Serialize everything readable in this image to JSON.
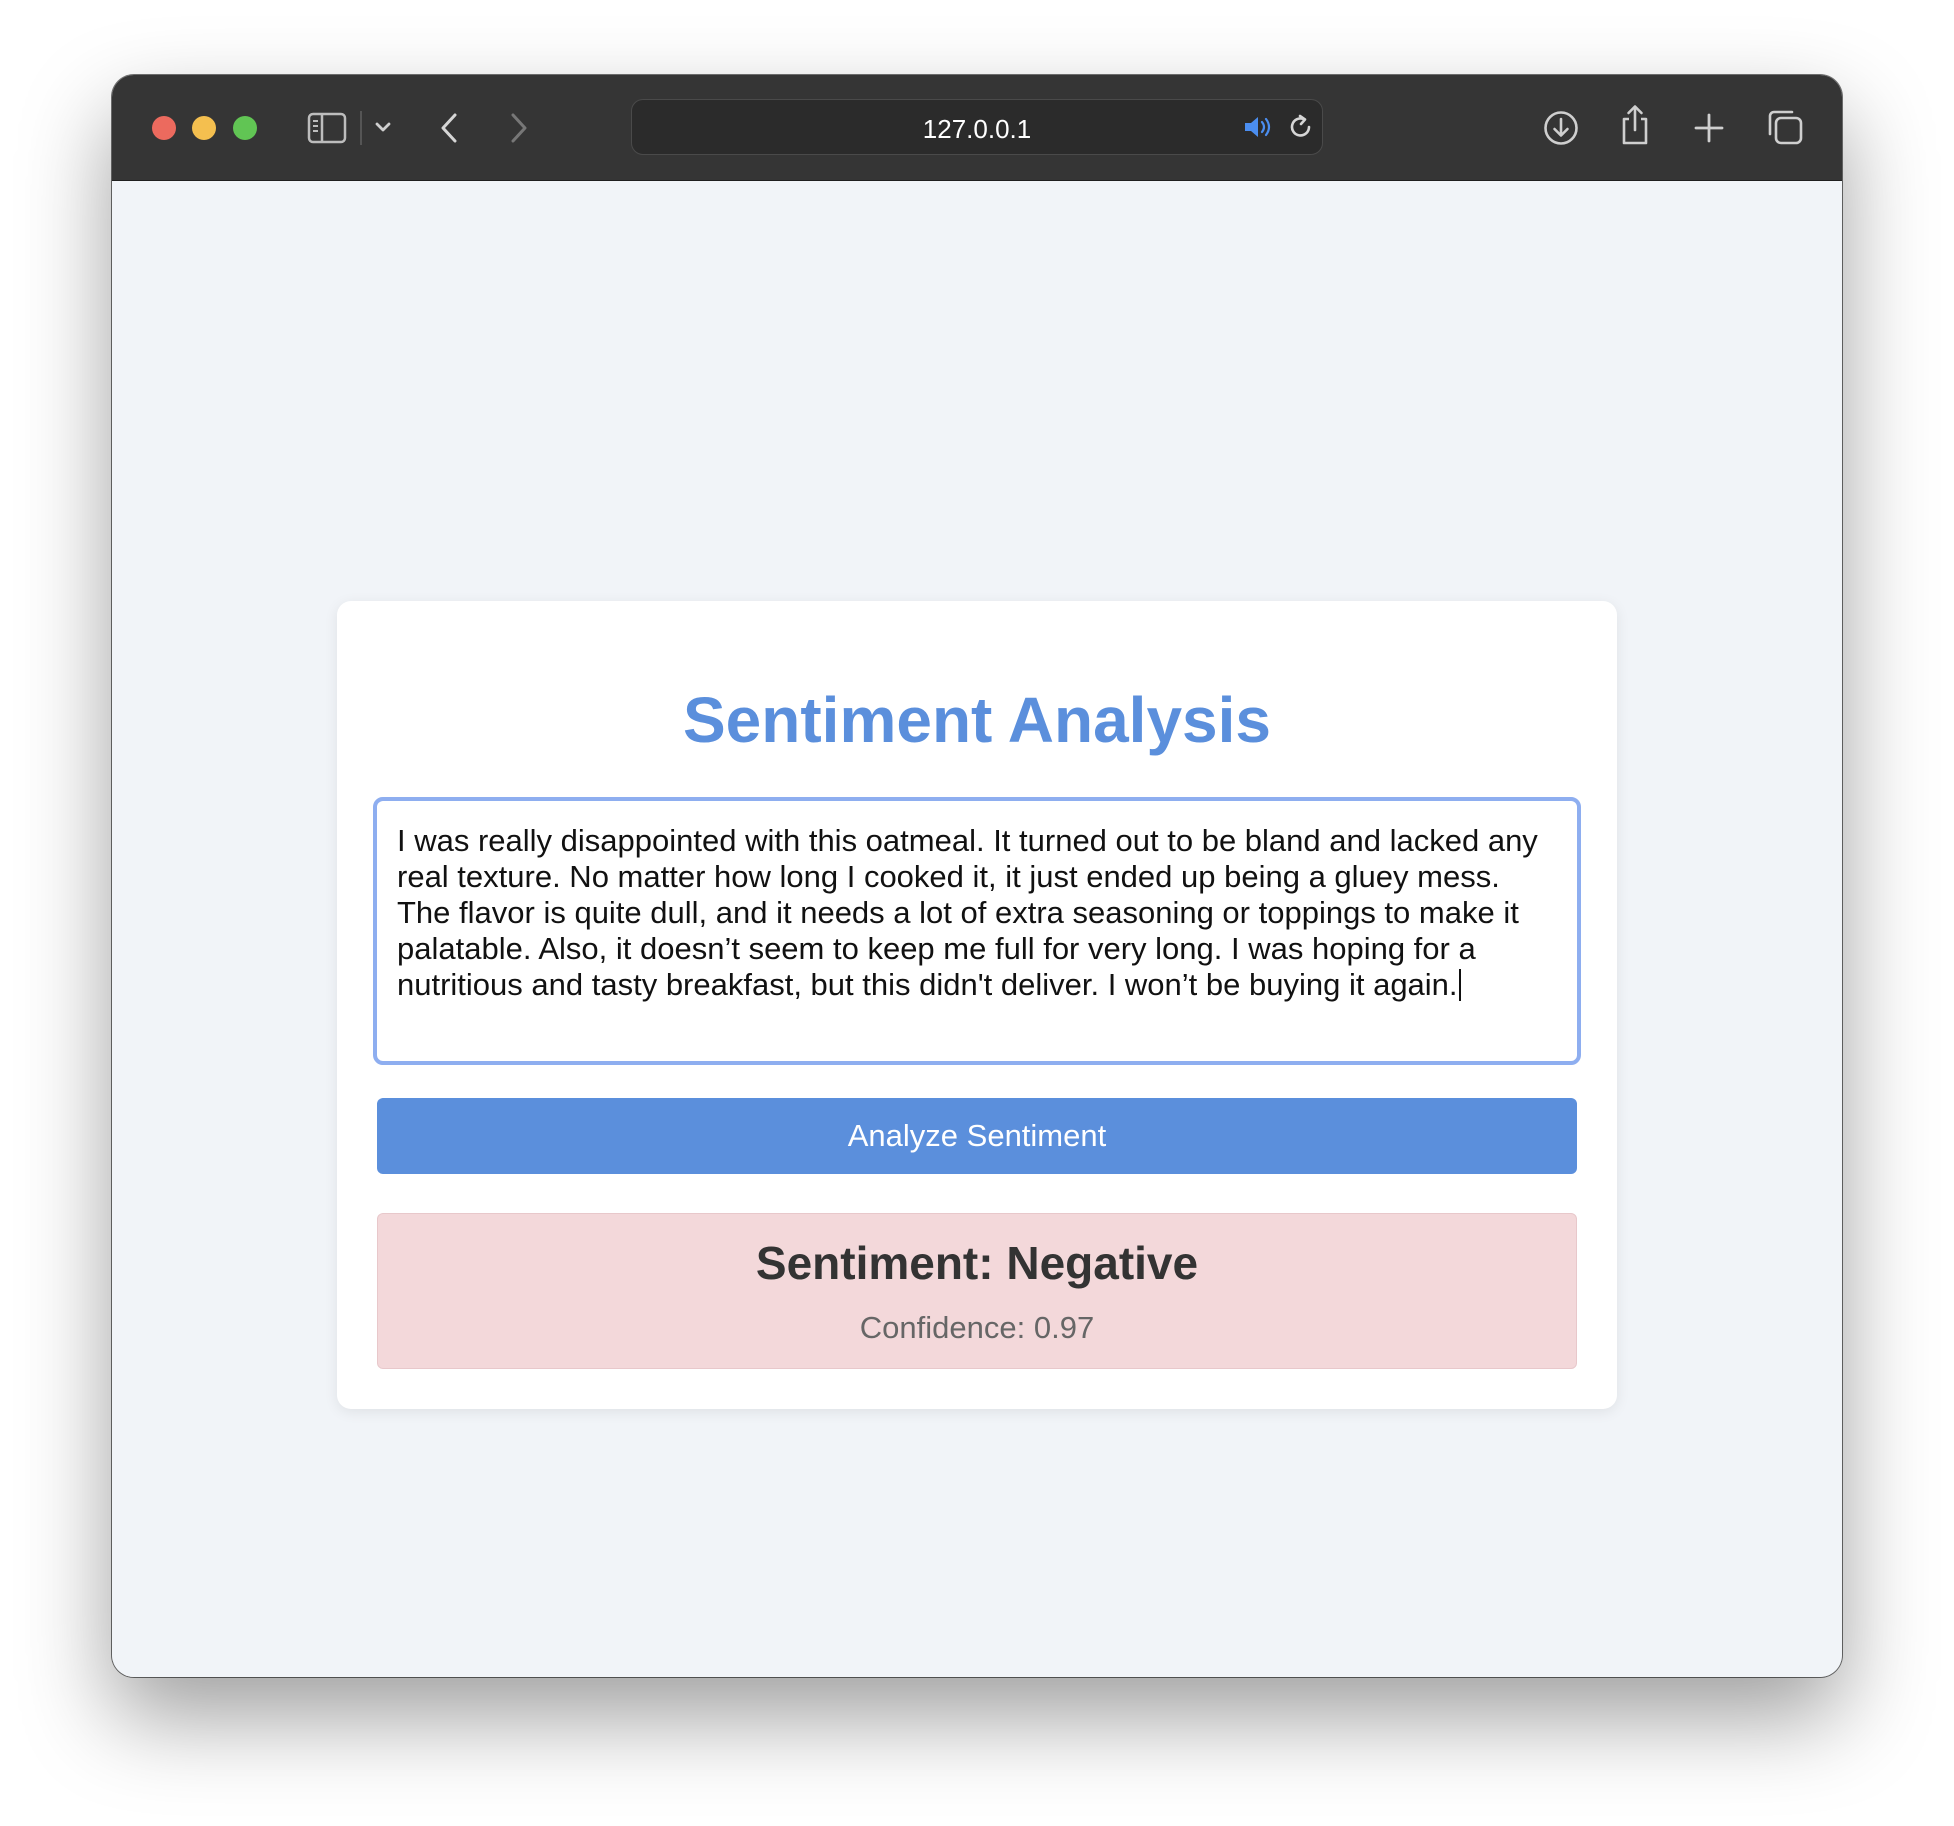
{
  "browser": {
    "url": "127.0.0.1",
    "colors": {
      "close": "#ec6a5e",
      "minimize": "#f4bf4f",
      "maximize": "#61c554",
      "toolbar": "#353535"
    }
  },
  "page": {
    "title": "Sentiment Analysis",
    "input_text": "I was really disappointed with this oatmeal. It turned out to be bland and lacked any real texture. No matter how long I cooked it, it just ended up being a gluey mess. The flavor is quite dull, and it needs a lot of extra seasoning or toppings to make it palatable. Also, it doesn’t seem to keep me full for very long. I was hoping for a nutritious and tasty breakfast, but this didn't deliver. I won’t be buying it again.",
    "analyze_button_label": "Analyze Sentiment",
    "result": {
      "sentiment_label": "Sentiment: Negative",
      "confidence_label": "Confidence: 0.97"
    },
    "colors": {
      "accent": "#5b8fdc",
      "negative_bg": "#f3d8da"
    }
  }
}
